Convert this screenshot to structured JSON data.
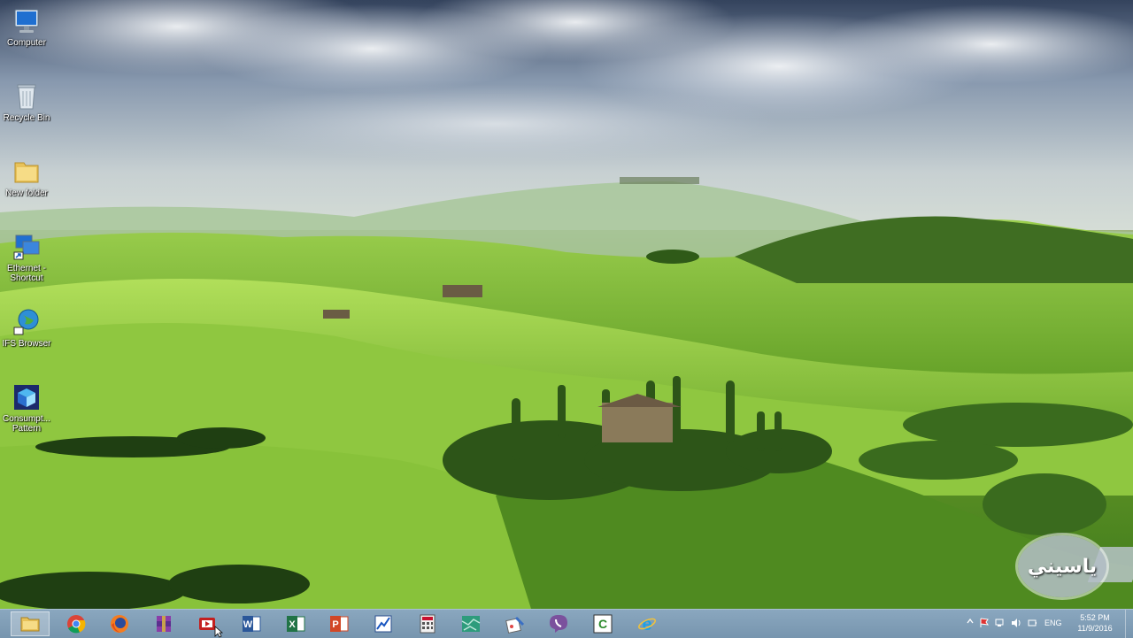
{
  "desktop": {
    "icons": [
      {
        "label": "Computer",
        "icon": "computer-icon"
      },
      {
        "label": "Recycle Bin",
        "icon": "recycle-bin-icon"
      },
      {
        "label": "New folder",
        "icon": "folder-icon"
      },
      {
        "label": "Ethernet - Shortcut",
        "icon": "network-shortcut-icon"
      },
      {
        "label": "IFS Browser",
        "icon": "globe-icon"
      },
      {
        "label": "Consumpt... Pattern",
        "icon": "cube-icon"
      }
    ],
    "watermark_text": "ياسيني"
  },
  "taskbar": {
    "apps": [
      {
        "name": "File Explorer",
        "icon": "folder-icon"
      },
      {
        "name": "Google Chrome",
        "icon": "chrome-icon"
      },
      {
        "name": "Mozilla Firefox",
        "icon": "firefox-icon"
      },
      {
        "name": "WinRAR",
        "icon": "archive-icon"
      },
      {
        "name": "Video Converter",
        "icon": "video-converter-icon"
      },
      {
        "name": "Microsoft Word",
        "icon": "word-icon",
        "letter": "W"
      },
      {
        "name": "Microsoft Excel",
        "icon": "excel-icon",
        "letter": "X"
      },
      {
        "name": "Microsoft PowerPoint",
        "icon": "powerpoint-icon",
        "letter": "P"
      },
      {
        "name": "Project Tool",
        "icon": "chart-tool-icon"
      },
      {
        "name": "Calculator",
        "icon": "calculator-icon"
      },
      {
        "name": "Map Tool",
        "icon": "map-icon"
      },
      {
        "name": "Paint",
        "icon": "paint-icon"
      },
      {
        "name": "Viber",
        "icon": "viber-icon"
      },
      {
        "name": "Camtasia",
        "icon": "camtasia-icon",
        "letter": "C"
      },
      {
        "name": "Internet Explorer",
        "icon": "ie-icon",
        "letter": "e"
      }
    ],
    "tray": {
      "language": "ENG",
      "time": "5:52 PM",
      "date": "11/9/2016"
    }
  },
  "colors": {
    "taskbar": "#7b98b0",
    "word": "#2b579a",
    "excel": "#217346",
    "powerpoint": "#d24726",
    "viber": "#7b519d"
  }
}
